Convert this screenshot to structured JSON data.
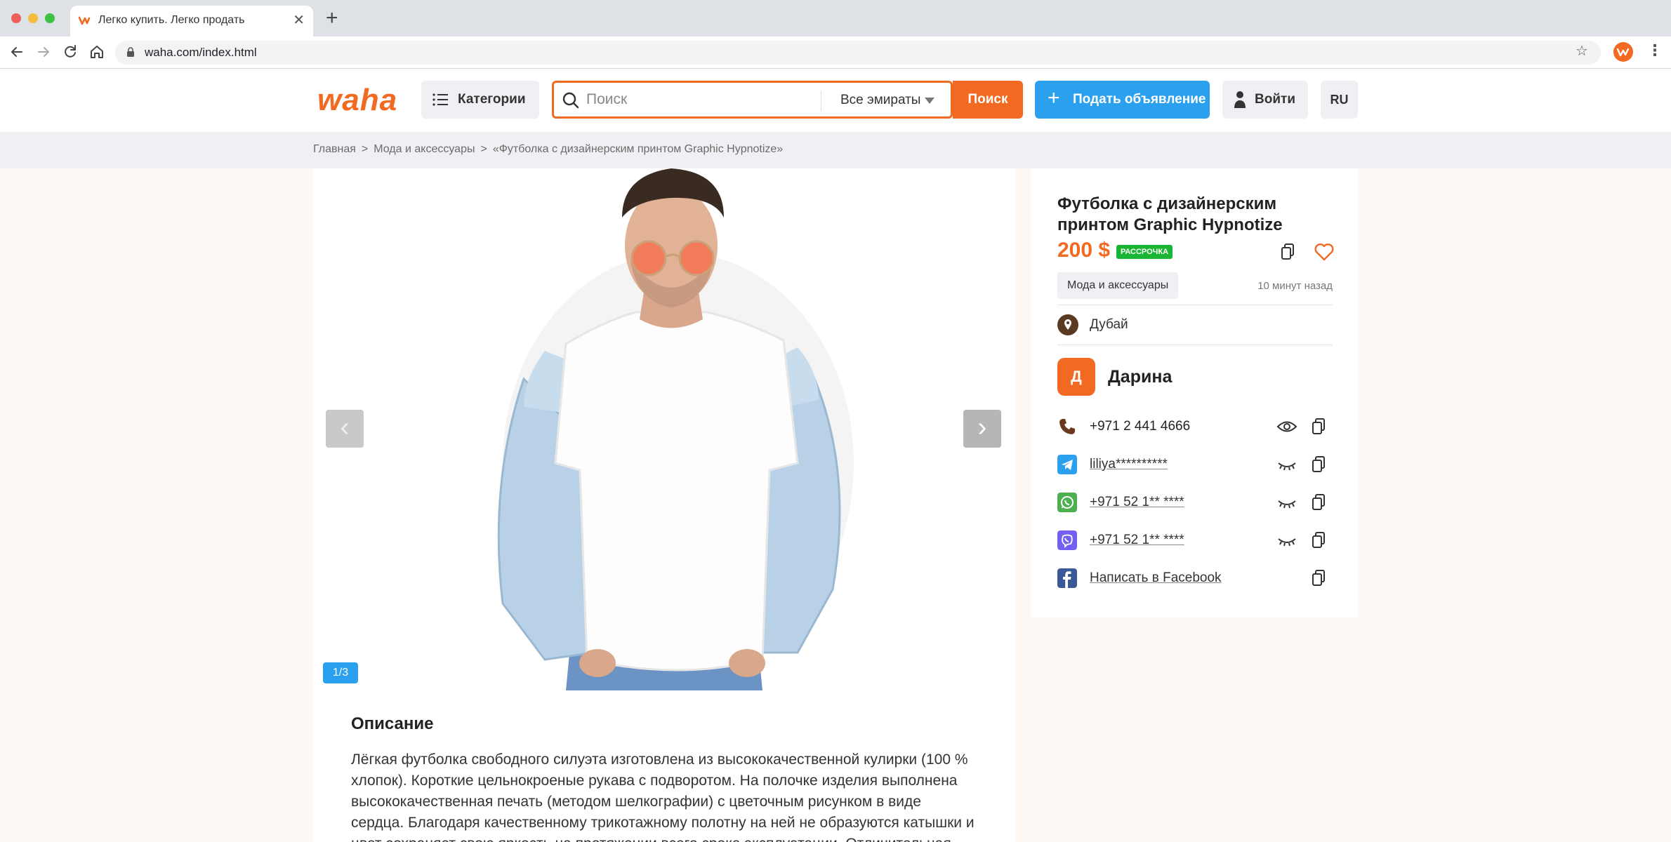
{
  "browser": {
    "tab_title": "Легко купить. Легко продать",
    "url": "waha.com/index.html",
    "icons": [
      "back-icon",
      "forward-icon",
      "reload-icon",
      "home-icon",
      "lock-icon",
      "star-icon",
      "menu-icon"
    ]
  },
  "header": {
    "logo": "waha",
    "categories_label": "Категории",
    "search_placeholder": "Поиск",
    "region_label": "Все эмираты",
    "search_button": "Поиск",
    "post_button": "Подать объявление",
    "login_button": "Войти",
    "language": "RU",
    "accent_color": "#f26a21",
    "blue_color": "#2aa0ef"
  },
  "breadcrumb": {
    "home": "Главная",
    "category": "Мода и аксессуары",
    "current": "«Футболка с дизайнерским принтом Graphic Hypnotize»",
    "separator": ">"
  },
  "gallery": {
    "prev_arrow": "‹",
    "next_arrow": "›",
    "counter": "1/3"
  },
  "description": {
    "heading": "Описание",
    "text": "Лёгкая футболка свободного силуэта изготовлена из высококачественной кулирки (100 % хлопок). Короткие цельнокроеные рукава с подворотом. На полочке изделия выполнена высококачественная печать (методом шелкографии) с цветочным рисунком в виде сердца. Благодаря качественному трикотажному полотну на ней не образуются катышки и цвет сохраняет свою яркость на протяжении всего срока эксплуатации. Отличительная"
  },
  "listing": {
    "title": "Футболка с дизайнерским принтом Graphic Hypnotize",
    "price": "200 $",
    "installment_badge": "РАССРОЧКА",
    "category": "Мода и аксессуары",
    "posted": "10 минут назад",
    "location": "Дубай",
    "seller_initial": "Д",
    "seller_name": "Дарина",
    "contacts": [
      {
        "type": "phone",
        "value": "+971 2 441 4666",
        "icon": "phone-icon",
        "color": "#6b3a1e"
      },
      {
        "type": "telegram",
        "value": "liliya**********",
        "icon": "telegram-icon",
        "color": "#2aa0ef"
      },
      {
        "type": "whatsapp",
        "value": "+971 52 1** ****",
        "icon": "whatsapp-icon",
        "color": "#4caf50"
      },
      {
        "type": "viber",
        "value": "+971 52 1** ****",
        "icon": "viber-icon",
        "color": "#7360f2"
      },
      {
        "type": "facebook",
        "value": "Написать в Facebook",
        "icon": "facebook-icon",
        "color": "#3b5998"
      }
    ]
  }
}
